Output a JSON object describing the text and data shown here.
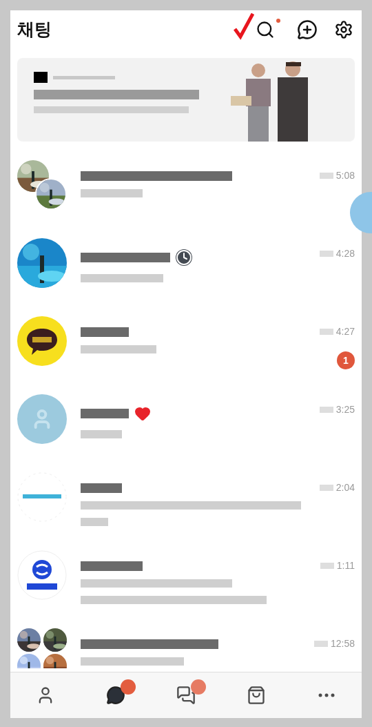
{
  "header": {
    "title": "채팅",
    "search_dot": true
  },
  "chats": [
    {
      "avatar": {
        "kind": "group"
      },
      "time": "5:08"
    },
    {
      "name_icon": {
        "kind": "clock"
      },
      "time": "4:28"
    },
    {
      "avatar": {
        "kind": "bubble"
      },
      "time": "4:27",
      "unread": "1"
    },
    {
      "avatar": {
        "kind": "default"
      },
      "name_icon": {
        "kind": "heart"
      },
      "time": "3:25"
    },
    {
      "avatar": {
        "kind": "wave"
      },
      "time": "2:04"
    },
    {
      "avatar": {
        "kind": "sphere"
      },
      "time": "1:11"
    },
    {
      "avatar": {
        "kind": "quad"
      },
      "time": "12:58"
    }
  ],
  "nav": [
    {
      "kind": "friends",
      "selected": false,
      "badge": false
    },
    {
      "kind": "chats",
      "selected": true,
      "badge": true
    },
    {
      "kind": "openchat",
      "selected": false,
      "badge": true
    },
    {
      "kind": "shopping",
      "selected": false,
      "badge": false
    },
    {
      "kind": "more",
      "selected": false,
      "badge": false
    }
  ]
}
